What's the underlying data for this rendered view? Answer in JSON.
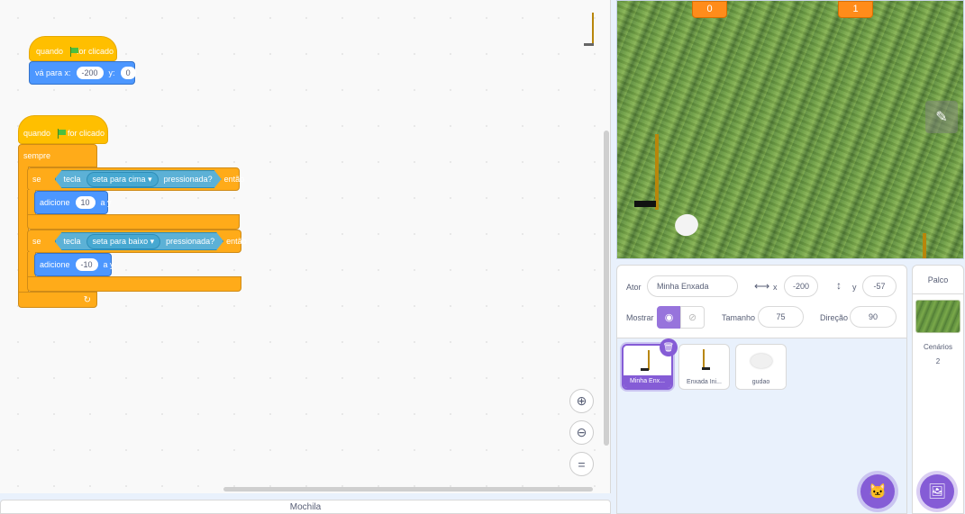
{
  "script1": {
    "hat_when": "quando",
    "hat_clicked": "for clicado",
    "goto_label": "vá para x:",
    "goto_x": "-200",
    "goto_y_label": "y:",
    "goto_y": "0"
  },
  "script2": {
    "hat_when": "quando",
    "hat_clicked": "for clicado",
    "forever": "sempre",
    "if1": {
      "se": "se",
      "key": "tecla",
      "key_value": "seta para cima",
      "pressed": "pressionada?",
      "then": "então",
      "add": "adicione",
      "value": "10",
      "to": "a y"
    },
    "if2": {
      "se": "se",
      "key": "tecla",
      "key_value": "seta para baixo",
      "pressed": "pressionada?",
      "then": "então",
      "add": "adicione",
      "value": "-10",
      "to": "a y"
    }
  },
  "zoom": {
    "in_icon": "zoom-in-icon",
    "out_icon": "zoom-out-icon",
    "reset_icon": "equals-icon"
  },
  "backpack": {
    "label": "Mochila"
  },
  "stage": {
    "score_left": "0",
    "score_right": "1"
  },
  "sprite_info": {
    "actor_label": "Ator",
    "actor_name": "Minha Enxada",
    "x_label": "x",
    "x_value": "-200",
    "y_label": "y",
    "y_value": "-57",
    "show_label": "Mostrar",
    "size_label": "Tamanho",
    "size_value": "75",
    "direction_label": "Direção",
    "direction_value": "90"
  },
  "sprites": [
    {
      "name": "Minha Enx...",
      "selected": true
    },
    {
      "name": "Enxada Ini...",
      "selected": false
    },
    {
      "name": "gudao",
      "selected": false
    }
  ],
  "stage_pane": {
    "title": "Palco",
    "backdrops_label": "Cenários",
    "backdrops_count": "2"
  },
  "colors": {
    "events": "#ffbf00",
    "motion": "#4c97ff",
    "control": "#ffab19",
    "sensing": "#5cb1d6",
    "accent": "#855cd6",
    "monitor": "#ff8c1a"
  }
}
